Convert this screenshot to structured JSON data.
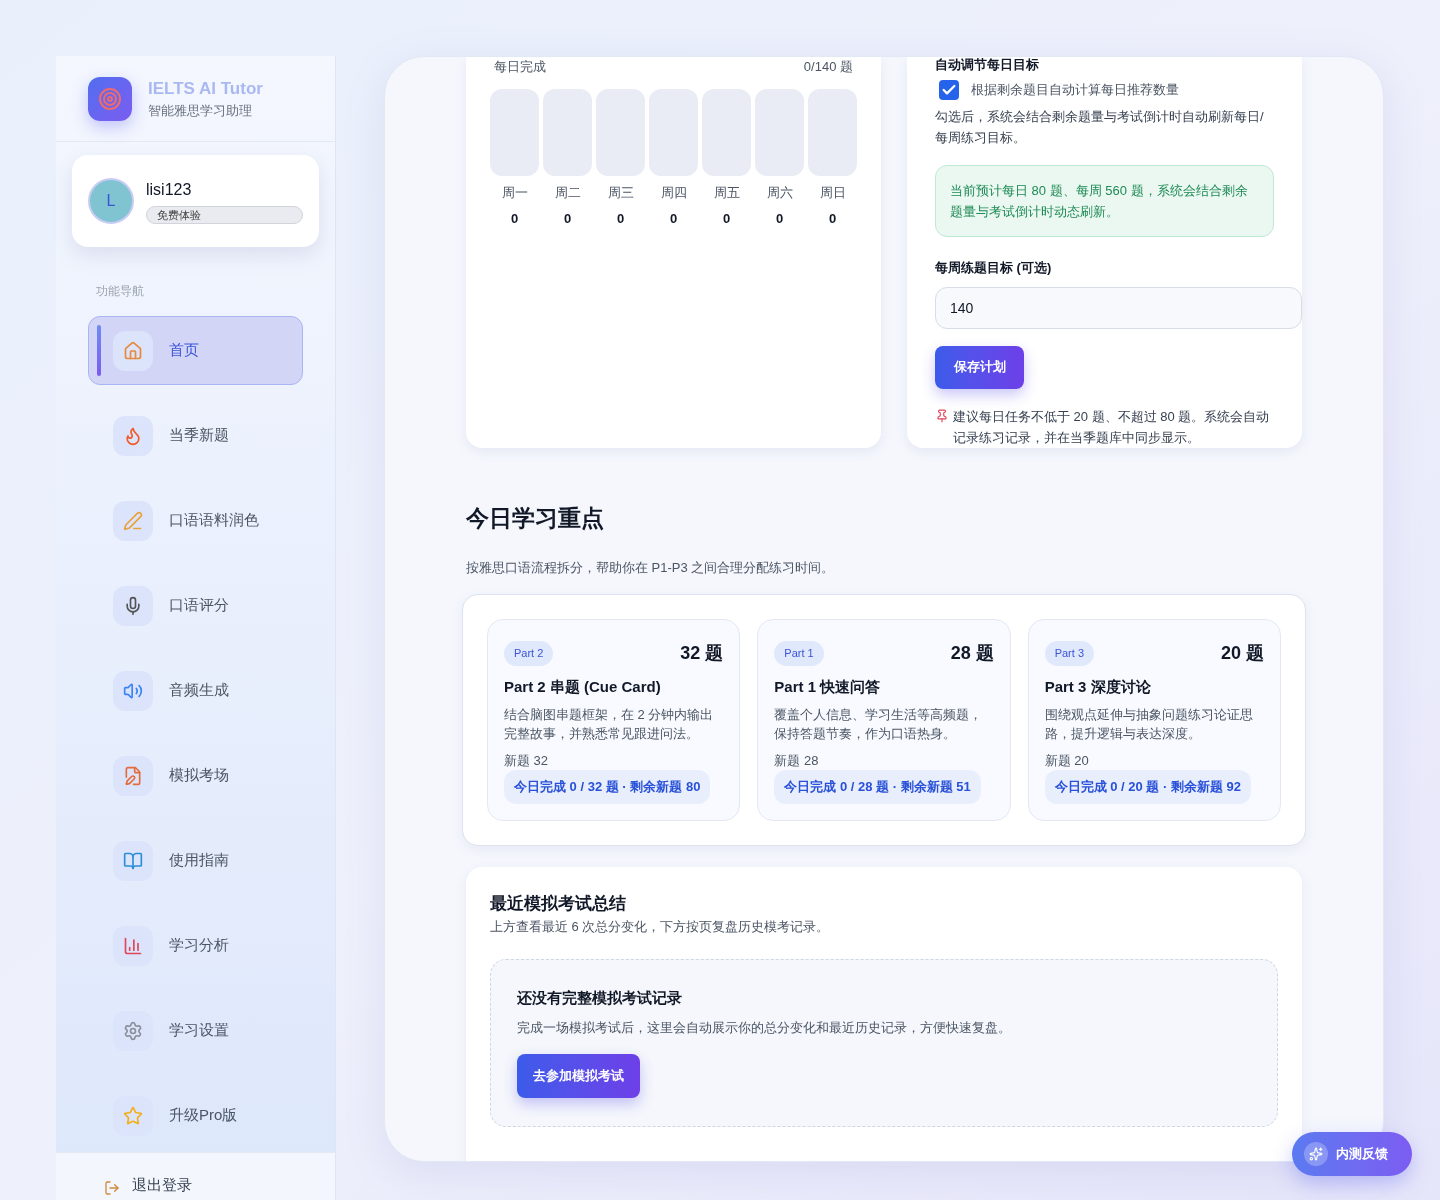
{
  "brand": {
    "title": "IELTS AI Tutor",
    "subtitle": "智能雅思学习助理"
  },
  "user": {
    "avatar_letter": "L",
    "name": "lisi123",
    "plan": "免费体验"
  },
  "nav": {
    "heading": "功能导航",
    "items": [
      {
        "label": "首页",
        "selected": true
      },
      {
        "label": "当季新题",
        "selected": false
      },
      {
        "label": "口语语料润色",
        "selected": false
      },
      {
        "label": "口语评分",
        "selected": false
      },
      {
        "label": "音频生成",
        "selected": false
      },
      {
        "label": "模拟考场",
        "selected": false
      },
      {
        "label": "使用指南",
        "selected": false
      },
      {
        "label": "学习分析",
        "selected": false
      },
      {
        "label": "学习设置",
        "selected": false
      },
      {
        "label": "升级Pro版",
        "selected": false
      }
    ]
  },
  "logout": "退出登录",
  "weekly_progress": {
    "label": "每日完成",
    "total": "0/140 题",
    "days": [
      {
        "day": "周一",
        "value": "0"
      },
      {
        "day": "周二",
        "value": "0"
      },
      {
        "day": "周三",
        "value": "0"
      },
      {
        "day": "周四",
        "value": "0"
      },
      {
        "day": "周五",
        "value": "0"
      },
      {
        "day": "周六",
        "value": "0"
      },
      {
        "day": "周日",
        "value": "0"
      }
    ]
  },
  "plan_settings": {
    "heading": "自动调节每日目标",
    "auto_checkbox": {
      "label": "根据剩余题目自动计算每日推荐数量",
      "checked": true
    },
    "auto_hint": "勾选后，系统会结合剩余题量与考试倒计时自动刷新每日/每周练习目标。",
    "estimate_note": "当前预计每日 80 题、每周 560 题，系统会结合剩余题量与考试倒计时动态刷新。",
    "weekly_goal_label": "每周练题目标 (可选)",
    "weekly_goal_value": "140",
    "save_button": "保存计划",
    "tip": "建议每日任务不低于 20 题、不超过 80 题。系统会自动记录练习记录，并在当季题库中同步显示。"
  },
  "focus": {
    "title": "今日学习重点",
    "subtitle": "按雅思口语流程拆分，帮助你在 P1-P3 之间合理分配练习时间。",
    "parts": [
      {
        "tag": "Part 2",
        "count": "32 题",
        "title": "Part 2 串题 (Cue Card)",
        "description": "结合脑图串题框架，在 2 分钟内输出完整故事，并熟悉常见跟进问法。",
        "new": "新题 32",
        "progress": "今日完成 0 / 32 题 · 剩余新题 80"
      },
      {
        "tag": "Part 1",
        "count": "28 题",
        "title": "Part 1 快速问答",
        "description": "覆盖个人信息、学习生活等高频题，保持答题节奏，作为口语热身。",
        "new": "新题 28",
        "progress": "今日完成 0 / 28 题 · 剩余新题 51"
      },
      {
        "tag": "Part 3",
        "count": "20 题",
        "title": "Part 3 深度讨论",
        "description": "围绕观点延伸与抽象问题练习论证思路，提升逻辑与表达深度。",
        "new": "新题 20",
        "progress": "今日完成 0 / 20 题 · 剩余新题 92"
      }
    ]
  },
  "mock_summary": {
    "title": "最近模拟考试总结",
    "subtitle": "上方查看最近 6 次总分变化，下方按页复盘历史模考记录。",
    "empty_title": "还没有完整模拟考试记录",
    "empty_text": "完成一场模拟考试后，这里会自动展示你的总分变化和最近历史记录，方便快速复盘。",
    "button": "去参加模拟考试"
  },
  "feedback_button": "内测反馈"
}
